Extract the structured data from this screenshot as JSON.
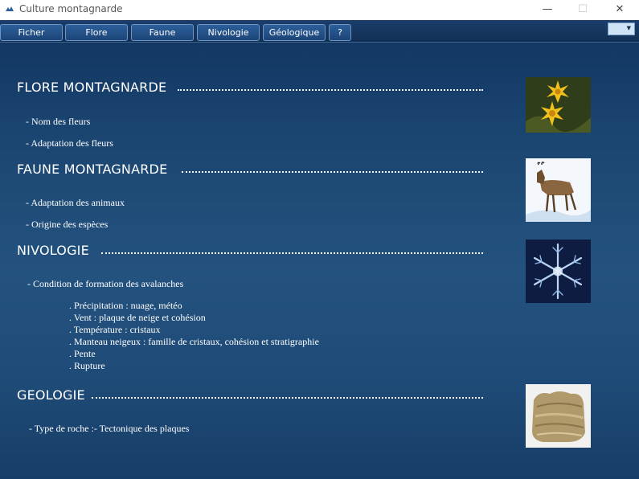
{
  "window": {
    "title": "Culture montagnarde",
    "minimize": "—",
    "maximize": "☐",
    "close": "✕"
  },
  "menu": [
    "Ficher",
    "Flore",
    "Faune",
    "Nivologie",
    "Géologique",
    "?"
  ],
  "sections": {
    "flore": {
      "title": "FLORE MONTAGNARDE",
      "items": [
        "- Nom des fleurs",
        "- Adaptation des fleurs"
      ]
    },
    "faune": {
      "title": "FAUNE MONTAGNARDE",
      "items": [
        "- Adaptation des animaux",
        "- Origine des espèces"
      ]
    },
    "nivologie": {
      "title": "NIVOLOGIE",
      "items": [
        "- Condition de formation des avalanches"
      ],
      "subitems": [
        ". Précipitation : nuage, météo",
        ". Vent : plaque de neige et cohésion",
        ". Température :  cristaux",
        ". Manteau neigeux : famille de cristaux, cohésion et stratigraphie",
        ". Pente",
        ". Rupture"
      ]
    },
    "geologie": {
      "title": "GEOLOGIE",
      "items": [
        "- Type de roche :- Tectonique des plaques"
      ]
    }
  },
  "images": {
    "flore": "flower-photo",
    "faune": "chamois-drawing",
    "nivologie": "snowflake-photo",
    "geologie": "rock-photo"
  }
}
